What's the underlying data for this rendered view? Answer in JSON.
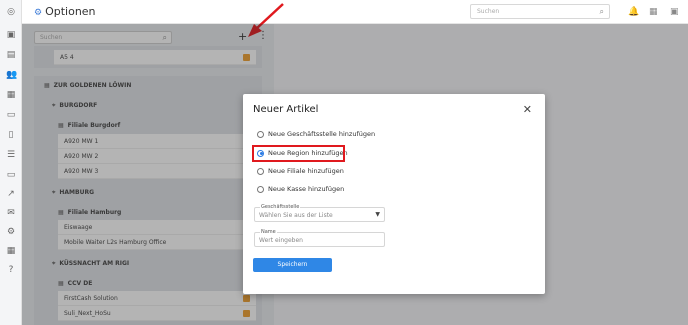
{
  "header": {
    "title": "Optionen",
    "search_placeholder": "Suchen"
  },
  "tree": {
    "search_placeholder": "Suchen",
    "top_item": "A5 4",
    "company": "ZUR GOLDENEN LÖWIN",
    "regions": [
      {
        "name": "BURGDORF",
        "branch": "Filiale Burgdorf",
        "registers": [
          "A920 MW 1",
          "A920 MW 2",
          "A920 MW 3"
        ]
      },
      {
        "name": "HAMBURG",
        "branch": "Filiale Hamburg",
        "registers": [
          "Eiswaage",
          "Mobile Waiter L2s Hamburg Office"
        ]
      },
      {
        "name": "KÜSSNACHT AM RIGI",
        "branch": "CCV DE",
        "registers": [
          "FirstCash Solution",
          "Suli_Next_HoSu"
        ]
      }
    ]
  },
  "modal": {
    "title": "Neuer Artikel",
    "options": [
      {
        "label": "Neue Geschäftsstelle hinzufügen",
        "selected": false
      },
      {
        "label": "Neue Region hinzufügen",
        "selected": true
      },
      {
        "label": "Neue Filiale hinzufügen",
        "selected": false
      },
      {
        "label": "Neue Kasse hinzufügen",
        "selected": false
      }
    ],
    "office_field": {
      "label": "Geschäftsstelle",
      "value": "Wählen Sie aus der Liste"
    },
    "name_field": {
      "label": "Name",
      "placeholder": "Wert eingeben"
    },
    "save_label": "Speichern"
  },
  "colors": {
    "accent": "#2f87e6",
    "highlight": "#e0191e",
    "badge": "#f0a030"
  }
}
